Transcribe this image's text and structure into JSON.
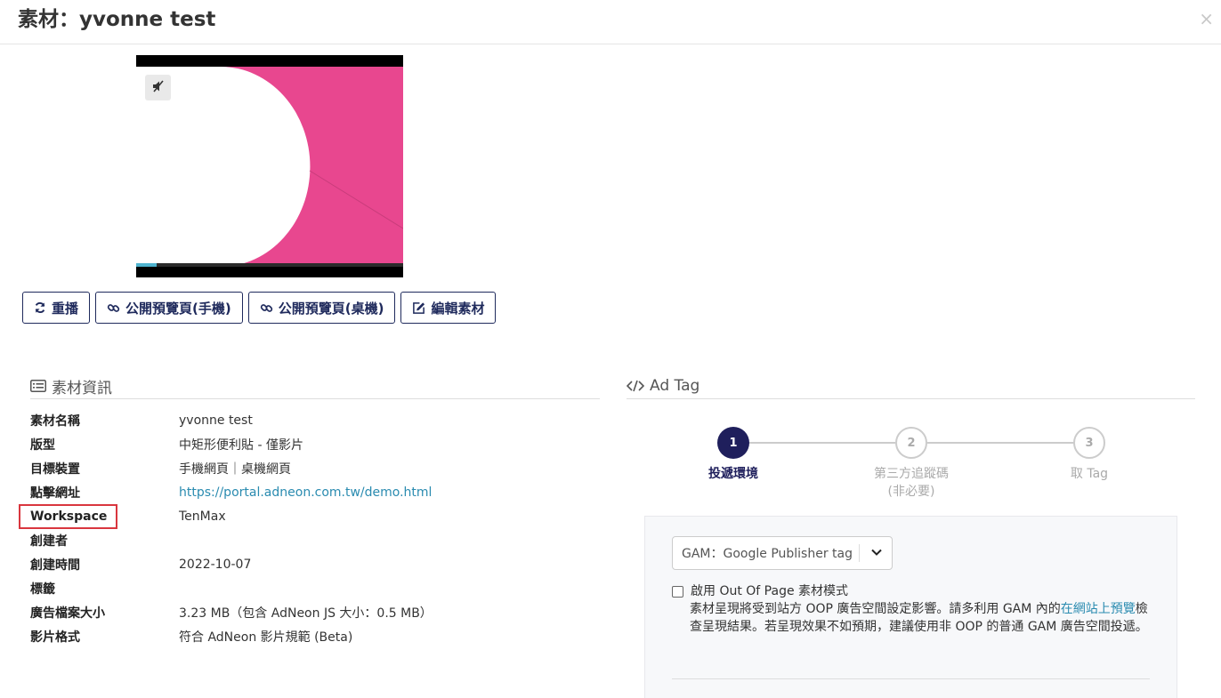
{
  "modal": {
    "title": "素材：yvonne test",
    "close_glyph": "×"
  },
  "preview": {
    "mute_icon": "mute-speaker-icon",
    "progress_fraction": 0.075,
    "accent": "#e8478f"
  },
  "actions": [
    {
      "icon": "refresh-icon",
      "label": "重播"
    },
    {
      "icon": "link-icon",
      "label": "公開預覽頁(手機)"
    },
    {
      "icon": "link-icon",
      "label": "公開預覽頁(桌機)"
    },
    {
      "icon": "edit-icon",
      "label": "編輯素材"
    }
  ],
  "info": {
    "heading": "素材資訊",
    "rows": [
      {
        "label": "素材名稱",
        "value": "yvonne test"
      },
      {
        "label": "版型",
        "value": "中矩形便利貼 - 僅影片"
      },
      {
        "label": "目標裝置",
        "value": "手機網頁｜桌機網頁"
      },
      {
        "label": "點擊網址",
        "value": "https://portal.adneon.com.tw/demo.html"
      },
      {
        "label": "Workspace",
        "value": "TenMax"
      },
      {
        "label": "創建者",
        "value": ""
      },
      {
        "label": "創建時間",
        "value": "2022-10-07"
      },
      {
        "label": "標籤",
        "value": ""
      },
      {
        "label": "廣告檔案大小",
        "value": "3.23 MB（包含 AdNeon JS 大小：0.5 MB）"
      },
      {
        "label": "影片格式",
        "value": "符合 AdNeon 影片規範 (Beta)"
      }
    ]
  },
  "adtag": {
    "heading": "Ad Tag",
    "steps": [
      {
        "number": "1",
        "label": "投遞環境",
        "sublabel": "",
        "active": true
      },
      {
        "number": "2",
        "label": "第三方追蹤碼",
        "sublabel": "(非必要)",
        "active": false
      },
      {
        "number": "3",
        "label": "取 Tag",
        "sublabel": "",
        "active": false
      }
    ],
    "select_value": "GAM：Google Publisher tag",
    "oop": {
      "checkbox_label": "啟用 Out Of Page 素材模式",
      "desc_part1": "素材呈現將受到站方 OOP 廣告空間設定影響。請多利用 GAM 內的",
      "desc_link": "在網站上預覽",
      "desc_part2": "檢查呈現結果。若呈現效果不如預期，建議使用非 OOP 的普通 GAM 廣告空間投遞。"
    }
  },
  "colors": {
    "primary": "#1f2a5c",
    "link": "#2a8bb0",
    "highlight": "#d9363e"
  }
}
